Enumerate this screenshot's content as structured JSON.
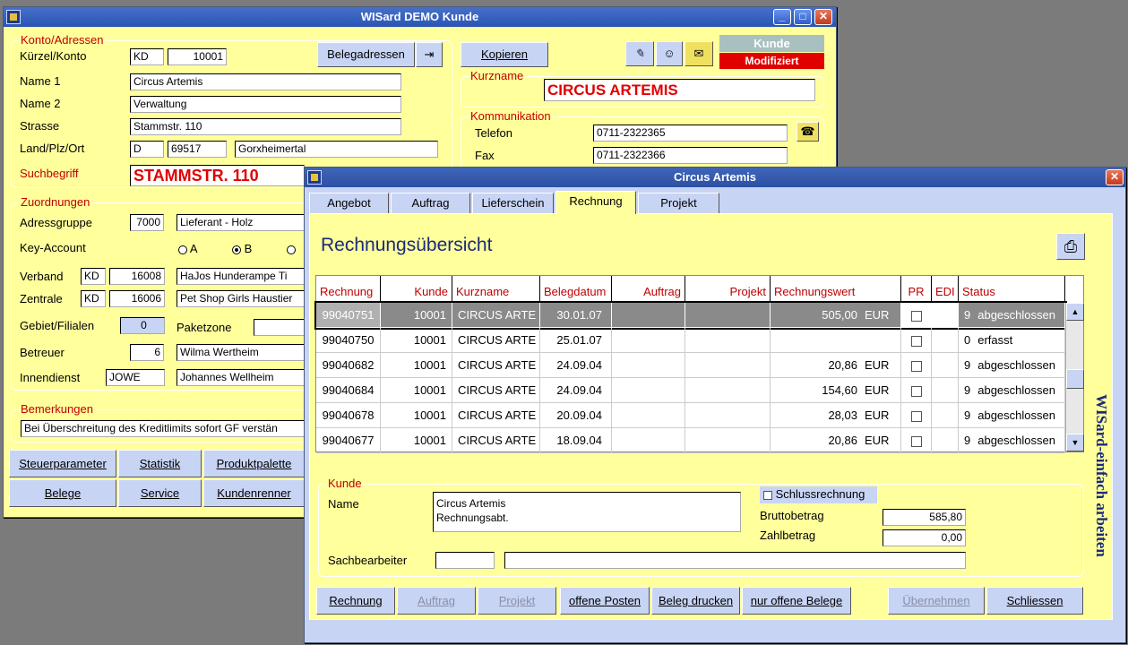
{
  "main_window": {
    "title": "WISard DEMO Kunde",
    "konto": {
      "legend": "Konto/Adressen",
      "kuerzel_label": "Kürzel/Konto",
      "kuerzel": "KD",
      "konto": "10001",
      "name1_label": "Name 1",
      "name1": "Circus Artemis",
      "name2_label": "Name 2",
      "name2": "Verwaltung",
      "strasse_label": "Strasse",
      "strasse": "Stammstr. 110",
      "land_label": "Land/Plz/Ort",
      "land": "D",
      "plz": "69517",
      "ort": "Gorxheimertal",
      "suchbegriff_label": "Suchbegriff",
      "suchbegriff": "STAMMSTR. 110"
    },
    "belegadressen_button": "Belegadressen",
    "kopieren_button": "Kopieren",
    "status": {
      "title": "Kunde",
      "state": "Modifiziert"
    },
    "kurzname": {
      "legend": "Kurzname",
      "value": "CIRCUS ARTEMIS"
    },
    "kommunikation": {
      "legend": "Kommunikation",
      "telefon_label": "Telefon",
      "telefon": "0711-2322365",
      "fax_label": "Fax",
      "fax": "0711-2322366"
    },
    "zuordnungen": {
      "legend": "Zuordnungen",
      "adressgruppe_label": "Adressgruppe",
      "adressgruppe_code": "7000",
      "adressgruppe": "Lieferant - Holz",
      "keyaccount_label": "Key-Account",
      "radio_a": "A",
      "radio_b": "B",
      "verband_label": "Verband",
      "verband_kd": "KD",
      "verband_nr": "16008",
      "verband_name": "HaJos Hunderampe Ti",
      "zentrale_label": "Zentrale",
      "zentrale_kd": "KD",
      "zentrale_nr": "16006",
      "zentrale_name": "Pet Shop Girls Haustier",
      "gebiet_label": "Gebiet/Filialen",
      "gebiet": "0",
      "paketzone_label": "Paketzone",
      "betreuer_label": "Betreuer",
      "betreuer_nr": "6",
      "betreuer_name": "Wilma Wertheim",
      "innendienst_label": "Innendienst",
      "innendienst_code": "JOWE",
      "innendienst_name": "Johannes Wellheim"
    },
    "bemerkungen": {
      "legend": "Bemerkungen",
      "text": "Bei Überschreitung des Kreditlimits sofort GF verstän"
    },
    "buttons": {
      "steuer": "Steuerparameter",
      "statistik": "Statistik",
      "produkt": "Produktpalette",
      "belege": "Belege",
      "service": "Service",
      "kundenrenner": "Kundenrenner"
    }
  },
  "dialog": {
    "title": "Circus Artemis",
    "tabs": [
      "Angebot",
      "Auftrag",
      "Lieferschein",
      "Rechnung",
      "Projekt"
    ],
    "heading": "Rechnungsübersicht",
    "columns": [
      "Rechnung",
      "Kunde",
      "Kurzname",
      "Belegdatum",
      "Auftrag",
      "Projekt",
      "Rechnungswert",
      "PR",
      "EDI",
      "Status"
    ],
    "rows": [
      {
        "rechnung": "99040751",
        "kunde": "10001",
        "kurzname": "CIRCUS ARTE",
        "datum": "30.01.07",
        "auftrag": "",
        "projekt": "",
        "wert": "505,00",
        "waehrung": "EUR",
        "status_code": "9",
        "status": "abgeschlossen"
      },
      {
        "rechnung": "99040750",
        "kunde": "10001",
        "kurzname": "CIRCUS ARTE",
        "datum": "25.01.07",
        "auftrag": "",
        "projekt": "",
        "wert": "",
        "waehrung": "",
        "status_code": "0",
        "status": "erfasst"
      },
      {
        "rechnung": "99040682",
        "kunde": "10001",
        "kurzname": "CIRCUS ARTE",
        "datum": "24.09.04",
        "auftrag": "",
        "projekt": "",
        "wert": "20,86",
        "waehrung": "EUR",
        "status_code": "9",
        "status": "abgeschlossen"
      },
      {
        "rechnung": "99040684",
        "kunde": "10001",
        "kurzname": "CIRCUS ARTE",
        "datum": "24.09.04",
        "auftrag": "",
        "projekt": "",
        "wert": "154,60",
        "waehrung": "EUR",
        "status_code": "9",
        "status": "abgeschlossen"
      },
      {
        "rechnung": "99040678",
        "kunde": "10001",
        "kurzname": "CIRCUS ARTE",
        "datum": "20.09.04",
        "auftrag": "",
        "projekt": "",
        "wert": "28,03",
        "waehrung": "EUR",
        "status_code": "9",
        "status": "abgeschlossen"
      },
      {
        "rechnung": "99040677",
        "kunde": "10001",
        "kurzname": "CIRCUS ARTE",
        "datum": "18.09.04",
        "auftrag": "",
        "projekt": "",
        "wert": "20,86",
        "waehrung": "EUR",
        "status_code": "9",
        "status": "abgeschlossen"
      }
    ],
    "kunde": {
      "legend": "Kunde",
      "name_label": "Name",
      "name_line1": "Circus Artemis",
      "name_line2": "Rechnungsabt.",
      "schluss_label": "Schlussrechnung",
      "brutto_label": "Bruttobetrag",
      "brutto": "585,80",
      "zahl_label": "Zahlbetrag",
      "zahl": "0,00",
      "sach_label": "Sachbearbeiter"
    },
    "buttons": {
      "rechnung": "Rechnung",
      "auftrag": "Auftrag",
      "projekt": "Projekt",
      "offene_posten": "offene Posten",
      "beleg_drucken": "Beleg drucken",
      "nur_offene": "nur offene Belege",
      "uebernehmen": "Übernehmen",
      "schliessen": "Schliessen"
    },
    "brand": "WISard-einfach arbeiten"
  },
  "colors": {
    "panel": "#ffff9c",
    "button": "#c8d4f4",
    "label_red": "#c00000",
    "heading_blue": "#1a2a7a"
  }
}
